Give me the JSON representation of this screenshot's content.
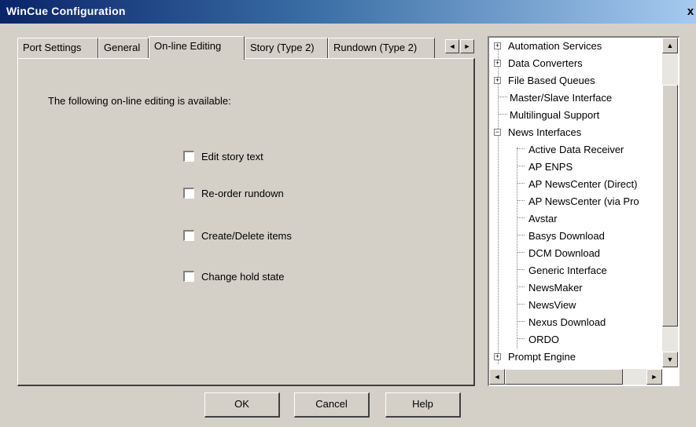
{
  "window": {
    "title": "WinCue Configuration",
    "close_glyph": "x"
  },
  "tabs": [
    {
      "label": "Port Settings",
      "active": false
    },
    {
      "label": "General",
      "active": false
    },
    {
      "label": "On-line Editing",
      "active": true
    },
    {
      "label": "Story (Type 2)",
      "active": false
    },
    {
      "label": "Rundown (Type 2)",
      "active": false
    }
  ],
  "tab_scroll": {
    "left": "◄",
    "right": "►"
  },
  "panel": {
    "intro": "The following on-line editing is available:",
    "options": [
      {
        "label": "Edit story text",
        "checked": false
      },
      {
        "label": "Re-order rundown",
        "checked": false
      },
      {
        "label": "Create/Delete items",
        "checked": false
      },
      {
        "label": "Change hold state",
        "checked": false
      }
    ]
  },
  "buttons": {
    "ok": "OK",
    "cancel": "Cancel",
    "help": "Help"
  },
  "tree": {
    "items": [
      {
        "label": "Automation Services",
        "expander": "+"
      },
      {
        "label": "Data Converters",
        "expander": "+"
      },
      {
        "label": "File Based Queues",
        "expander": "+"
      },
      {
        "label": "Master/Slave Interface",
        "expander": ""
      },
      {
        "label": "Multilingual Support",
        "expander": ""
      },
      {
        "label": "News Interfaces",
        "expander": "−"
      },
      {
        "label": "Active Data Receiver",
        "expander": ""
      },
      {
        "label": "AP ENPS",
        "expander": ""
      },
      {
        "label": "AP NewsCenter (Direct)",
        "expander": ""
      },
      {
        "label": "AP NewsCenter (via Pro",
        "expander": ""
      },
      {
        "label": "Avstar",
        "expander": ""
      },
      {
        "label": "Basys Download",
        "expander": ""
      },
      {
        "label": "DCM Download",
        "expander": ""
      },
      {
        "label": "Generic Interface",
        "expander": ""
      },
      {
        "label": "NewsMaker",
        "expander": ""
      },
      {
        "label": "NewsView",
        "expander": ""
      },
      {
        "label": "Nexus Download",
        "expander": ""
      },
      {
        "label": "ORDO",
        "expander": ""
      },
      {
        "label": "Prompt Engine",
        "expander": "+"
      }
    ],
    "scroll": {
      "up": "▲",
      "down": "▼",
      "left": "◄",
      "right": "►"
    }
  }
}
